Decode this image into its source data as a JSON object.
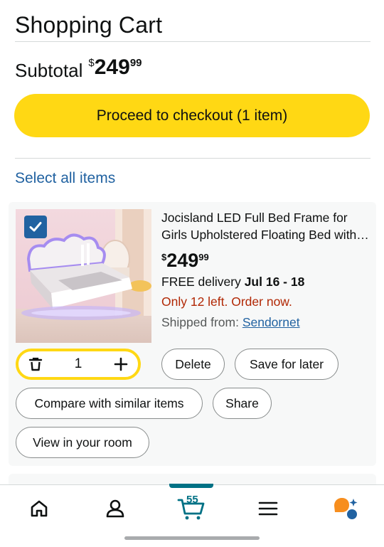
{
  "header": {
    "title": "Shopping Cart"
  },
  "subtotal": {
    "label": "Subtotal",
    "currency": "$",
    "whole": "249",
    "fraction": "99"
  },
  "checkout": {
    "label": "Proceed to checkout (1 item)"
  },
  "select_all": {
    "label": "Select all items"
  },
  "cart_item": {
    "title": "Jocisland LED Full Bed Frame for Girls Upholstered Floating Bed with LED Lights",
    "price": {
      "currency": "$",
      "whole": "249",
      "fraction": "99"
    },
    "delivery_prefix": "FREE delivery ",
    "delivery_date": "Jul 16 - 18",
    "stock": "Only 12 left. Order now.",
    "shipped_label": "Shipped from: ",
    "seller": "Sendornet",
    "quantity": "1",
    "selected": true,
    "actions": {
      "delete": "Delete",
      "save_for_later": "Save for later",
      "compare": "Compare with similar items",
      "share": "Share",
      "view_room": "View in your room"
    }
  },
  "nav": {
    "items": [
      "home-icon",
      "account-icon",
      "cart-icon",
      "menu-icon",
      "rufus-icon"
    ],
    "cart_count": "55",
    "active": "cart"
  },
  "colors": {
    "accent": "#ffd814",
    "link": "#2162a1",
    "stock": "#b12704",
    "nav_active": "#007185",
    "rufus": "#f78e1e"
  }
}
